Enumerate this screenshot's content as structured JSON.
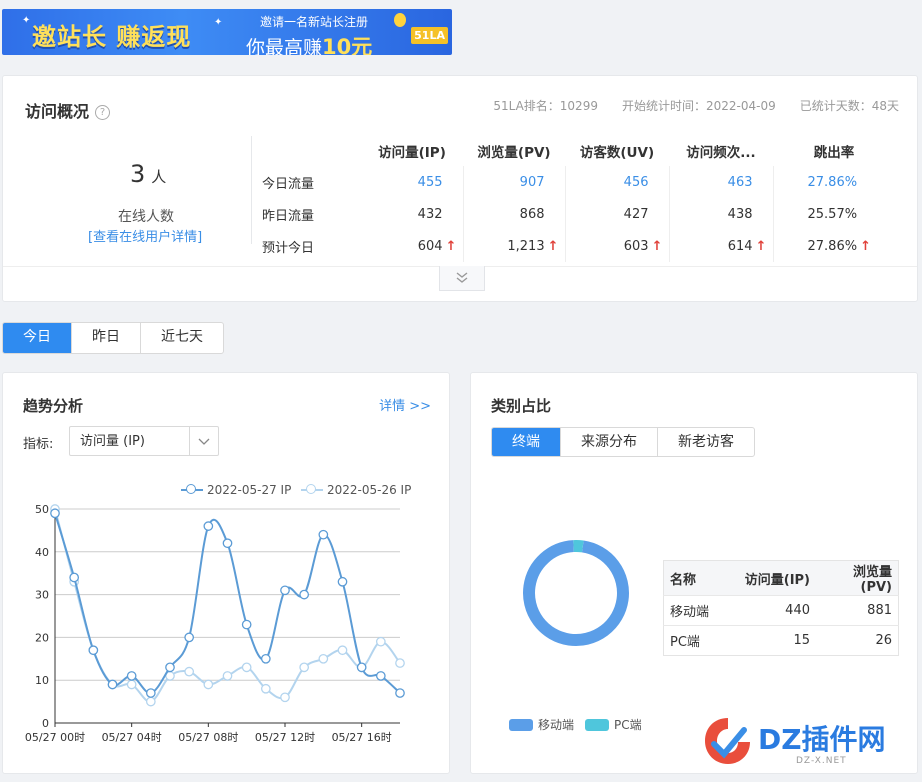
{
  "banner": {
    "headline": "邀站长 赚返现",
    "line1": "邀请一名新站长注册",
    "line2_prefix": "你最高赚",
    "line2_amount": "10元",
    "badge": "51LA"
  },
  "overview": {
    "title": "访问概况",
    "help_icon": "?",
    "rank": "51LA排名：10299",
    "start_date": "开始统计时间：2022-04-09",
    "days": "已统计天数：48天",
    "online_count": "3",
    "online_unit": "人",
    "online_label": "在线人数",
    "online_link": "[查看在线用户详情]",
    "columns": [
      "访问量(IP)",
      "浏览量(PV)",
      "访客数(UV)",
      "访问频次...",
      "跳出率"
    ],
    "rows": [
      {
        "label": "今日流量",
        "values": [
          "455",
          "907",
          "456",
          "463",
          "27.86%"
        ]
      },
      {
        "label": "昨日流量",
        "values": [
          "432",
          "868",
          "427",
          "438",
          "25.57%"
        ]
      },
      {
        "label": "预计今日",
        "values": [
          "604",
          "1,213",
          "603",
          "614",
          "27.86%"
        ]
      }
    ],
    "expand_icon": "chevron-double-down-icon"
  },
  "date_tabs": [
    "今日",
    "昨日",
    "近七天"
  ],
  "trend": {
    "title": "趋势分析",
    "detail": "详情 >>",
    "metric_label": "指标:",
    "metric_value": "访问量 (IP)"
  },
  "chart_data": {
    "type": "line",
    "title": "",
    "xlabel": "",
    "ylabel": "",
    "ylim": [
      0,
      50
    ],
    "yticks": [
      0,
      10,
      20,
      30,
      40,
      50
    ],
    "x_tick_labels": [
      "05/27 00时",
      "05/27 04时",
      "05/27 08时",
      "05/27 12时",
      "05/27 16时"
    ],
    "x_hours": [
      0,
      1,
      2,
      3,
      4,
      5,
      6,
      7,
      8,
      9,
      10,
      11,
      12,
      13,
      14,
      15,
      16,
      17,
      18
    ],
    "grid": true,
    "legend_position": "top-right",
    "series": [
      {
        "name": "2022-05-27 IP",
        "color": "#5b9bd5",
        "values": [
          49,
          34,
          17,
          9,
          11,
          7,
          13,
          20,
          46,
          42,
          23,
          15,
          31,
          30,
          44,
          33,
          13,
          11,
          7
        ]
      },
      {
        "name": "2022-05-26 IP",
        "color": "#b3d4ee",
        "values": [
          50,
          33,
          17,
          9,
          9,
          5,
          11,
          12,
          9,
          11,
          13,
          8,
          6,
          13,
          15,
          17,
          13,
          19,
          14
        ]
      }
    ]
  },
  "category": {
    "title": "类别占比",
    "tabs": [
      "终端",
      "来源分布",
      "新老访客"
    ],
    "table_headers": [
      "名称",
      "访问量(IP)",
      "浏览量(PV)"
    ],
    "table_rows": [
      {
        "name": "移动端",
        "ip": "440",
        "pv": "881"
      },
      {
        "name": "PC端",
        "ip": "15",
        "pv": "26"
      }
    ],
    "donut": [
      {
        "name": "移动端",
        "value": 440,
        "color": "#5b9ee8"
      },
      {
        "name": "PC端",
        "value": 15,
        "color": "#4fc6dc"
      }
    ],
    "legend": [
      "移动端",
      "PC端"
    ]
  },
  "watermark": {
    "text": "DZ插件网",
    "sub": "DZ-X.NET"
  }
}
